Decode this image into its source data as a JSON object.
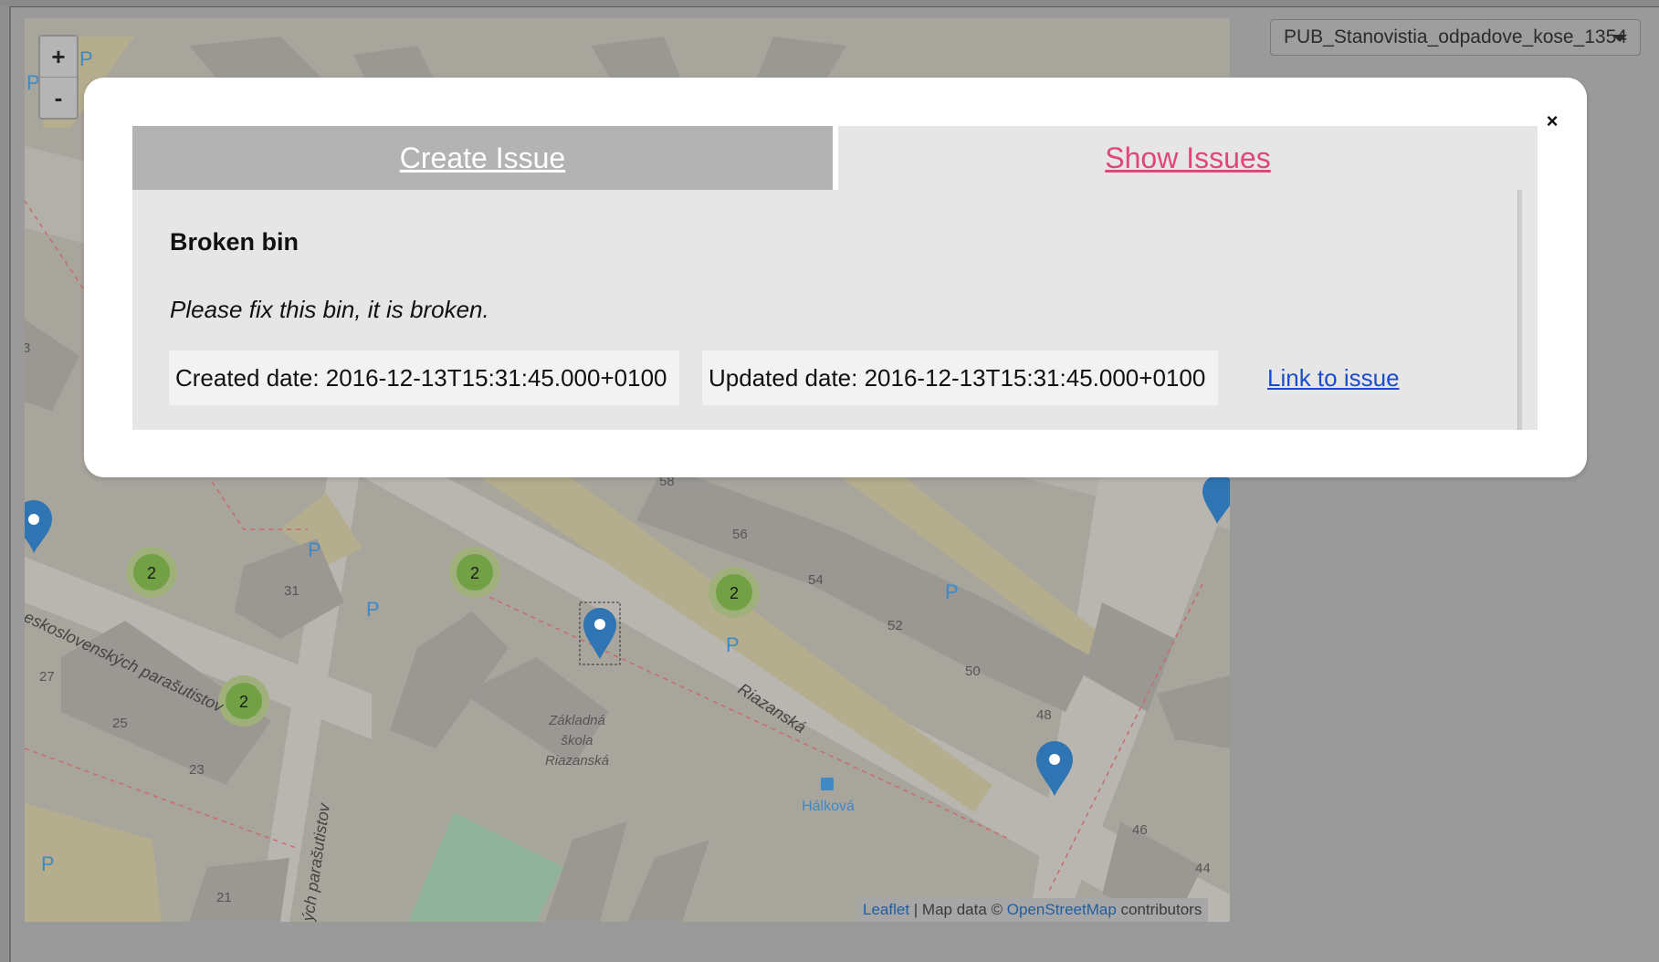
{
  "map": {
    "zoom_in_label": "+",
    "zoom_out_label": "-",
    "attribution": {
      "leaflet": "Leaflet",
      "sep": " | Map data © ",
      "osm": "OpenStreetMap",
      "tail": " contributors"
    },
    "clusters": [
      "2",
      "2",
      "2",
      "2"
    ],
    "street_labels": [
      "eskoslovenských parašutistov",
      "Riazanská",
      "ých parašutistov"
    ],
    "building_labels": [
      "Základná",
      "škola",
      "Riazanská"
    ],
    "stop_label": "Hálková",
    "house_numbers": [
      "58",
      "56",
      "54",
      "52",
      "50",
      "48",
      "46",
      "44",
      "31",
      "27",
      "25",
      "23",
      "21",
      "3"
    ],
    "parking_label": "P"
  },
  "layer_select": {
    "value": "PUB_Stanovistia_odpadove_kose_1354"
  },
  "modal": {
    "close_label": "×",
    "tabs": {
      "create": "Create Issue",
      "show": "Show Issues"
    },
    "issue": {
      "title": "Broken bin",
      "description": "Please fix this bin, it is broken.",
      "created": "Created date: 2016-12-13T15:31:45.000+0100",
      "updated": "Updated date: 2016-12-13T15:31:45.000+0100",
      "link": "Link to issue"
    }
  }
}
